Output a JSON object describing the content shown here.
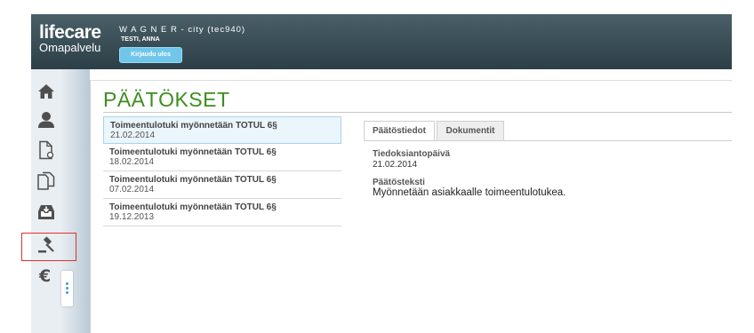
{
  "header": {
    "logo_main": "lifecare",
    "logo_sub": "Omapalvelu",
    "title": "W A G N E R - city (tec940)",
    "user": "TESTI, ANNA",
    "logout_label": "Kirjaudu ulos"
  },
  "sidebar": {
    "items": [
      {
        "name": "home",
        "icon": "home-icon"
      },
      {
        "name": "person",
        "icon": "person-icon"
      },
      {
        "name": "new-document",
        "icon": "document-add-icon"
      },
      {
        "name": "documents",
        "icon": "documents-icon"
      },
      {
        "name": "inbox",
        "icon": "inbox-icon"
      },
      {
        "name": "decisions",
        "icon": "gavel-icon"
      },
      {
        "name": "payments",
        "icon": "euro-icon"
      }
    ],
    "selected": "decisions",
    "highlight_color": "#e03030"
  },
  "page": {
    "title": "PÄÄTÖKSET",
    "title_color": "#3e8d1f"
  },
  "decisions": [
    {
      "title": "Toimeentulotuki myönnetään TOTUL 6§",
      "date": "21.02.2014",
      "selected": true
    },
    {
      "title": "Toimeentulotuki myönnetään TOTUL 6§",
      "date": "18.02.2014",
      "selected": false
    },
    {
      "title": "Toimeentulotuki myönnetään TOTUL 6§",
      "date": "07.02.2014",
      "selected": false
    },
    {
      "title": "Toimeentulotuki myönnetään TOTUL 6§",
      "date": "19.12.2013",
      "selected": false
    }
  ],
  "tabs": [
    {
      "label": "Päätöstiedot",
      "active": true
    },
    {
      "label": "Dokumentit",
      "active": false
    }
  ],
  "details": {
    "date_label": "Tiedoksiantopäivä",
    "date_value": "21.02.2014",
    "text_label": "Päätösteksti",
    "text_value": "Myönnetään asiakkaalle toimeentulotukea."
  }
}
